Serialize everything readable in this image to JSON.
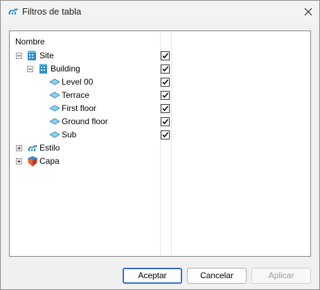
{
  "window": {
    "title": "Filtros de tabla",
    "close_glyph": "✕",
    "app_icon": "app-logo-icon"
  },
  "tree": {
    "column_header": "Nombre",
    "nodes": [
      {
        "label": "Site",
        "icon": "site-building-icon",
        "expanded": true,
        "checked": true
      },
      {
        "label": "Building",
        "icon": "building-icon",
        "expanded": true,
        "checked": true
      },
      {
        "label": "Level 00",
        "icon": "level-icon",
        "checked": true
      },
      {
        "label": "Terrace",
        "icon": "level-icon",
        "checked": true
      },
      {
        "label": "First floor",
        "icon": "level-icon",
        "checked": true
      },
      {
        "label": "Ground floor",
        "icon": "level-icon",
        "checked": true
      },
      {
        "label": "Sub",
        "icon": "level-icon",
        "checked": true
      },
      {
        "label": "Estilo",
        "icon": "style-icon",
        "expanded": false
      },
      {
        "label": "Capa",
        "icon": "layer-icon",
        "expanded": false
      }
    ]
  },
  "buttons": {
    "accept": "Aceptar",
    "cancel": "Cancelar",
    "apply": "Aplicar"
  },
  "colors": {
    "accent": "#2f6bc9",
    "level_icon": "#6fb3d6",
    "building_icon": "#2e8fc9",
    "layer_icon": "#d9532e"
  }
}
